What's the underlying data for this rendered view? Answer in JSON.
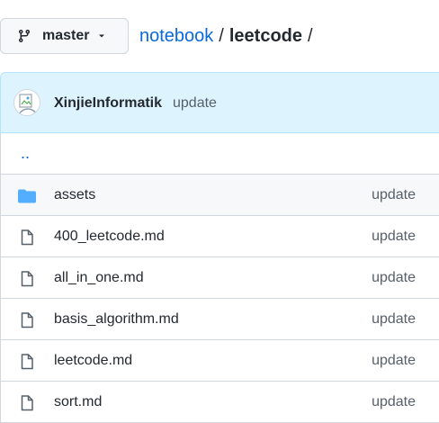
{
  "branch": {
    "name": "master",
    "icon": "git-branch-icon"
  },
  "breadcrumb": {
    "repo": "notebook",
    "separator": "/",
    "current": "leetcode",
    "trailing": "/"
  },
  "commit": {
    "author": "XinjieInformatik",
    "message": "update",
    "avatar_alt": "@XinjieInformatik"
  },
  "parent_dir": "..",
  "files": [
    {
      "name": "assets",
      "type": "folder",
      "icon": "folder-icon",
      "commit_msg": "update"
    },
    {
      "name": "400_leetcode.md",
      "type": "file",
      "icon": "file-icon",
      "commit_msg": "update"
    },
    {
      "name": "all_in_one.md",
      "type": "file",
      "icon": "file-icon",
      "commit_msg": "update"
    },
    {
      "name": "basis_algorithm.md",
      "type": "file",
      "icon": "file-icon",
      "commit_msg": "update"
    },
    {
      "name": "leetcode.md",
      "type": "file",
      "icon": "file-icon",
      "commit_msg": "update"
    },
    {
      "name": "sort.md",
      "type": "file",
      "icon": "file-icon",
      "commit_msg": "update"
    }
  ],
  "colors": {
    "link": "#0969da",
    "folder": "#54aeff",
    "commit_bg": "#ddf4ff",
    "border": "#d0d7de",
    "muted": "#57606a"
  }
}
